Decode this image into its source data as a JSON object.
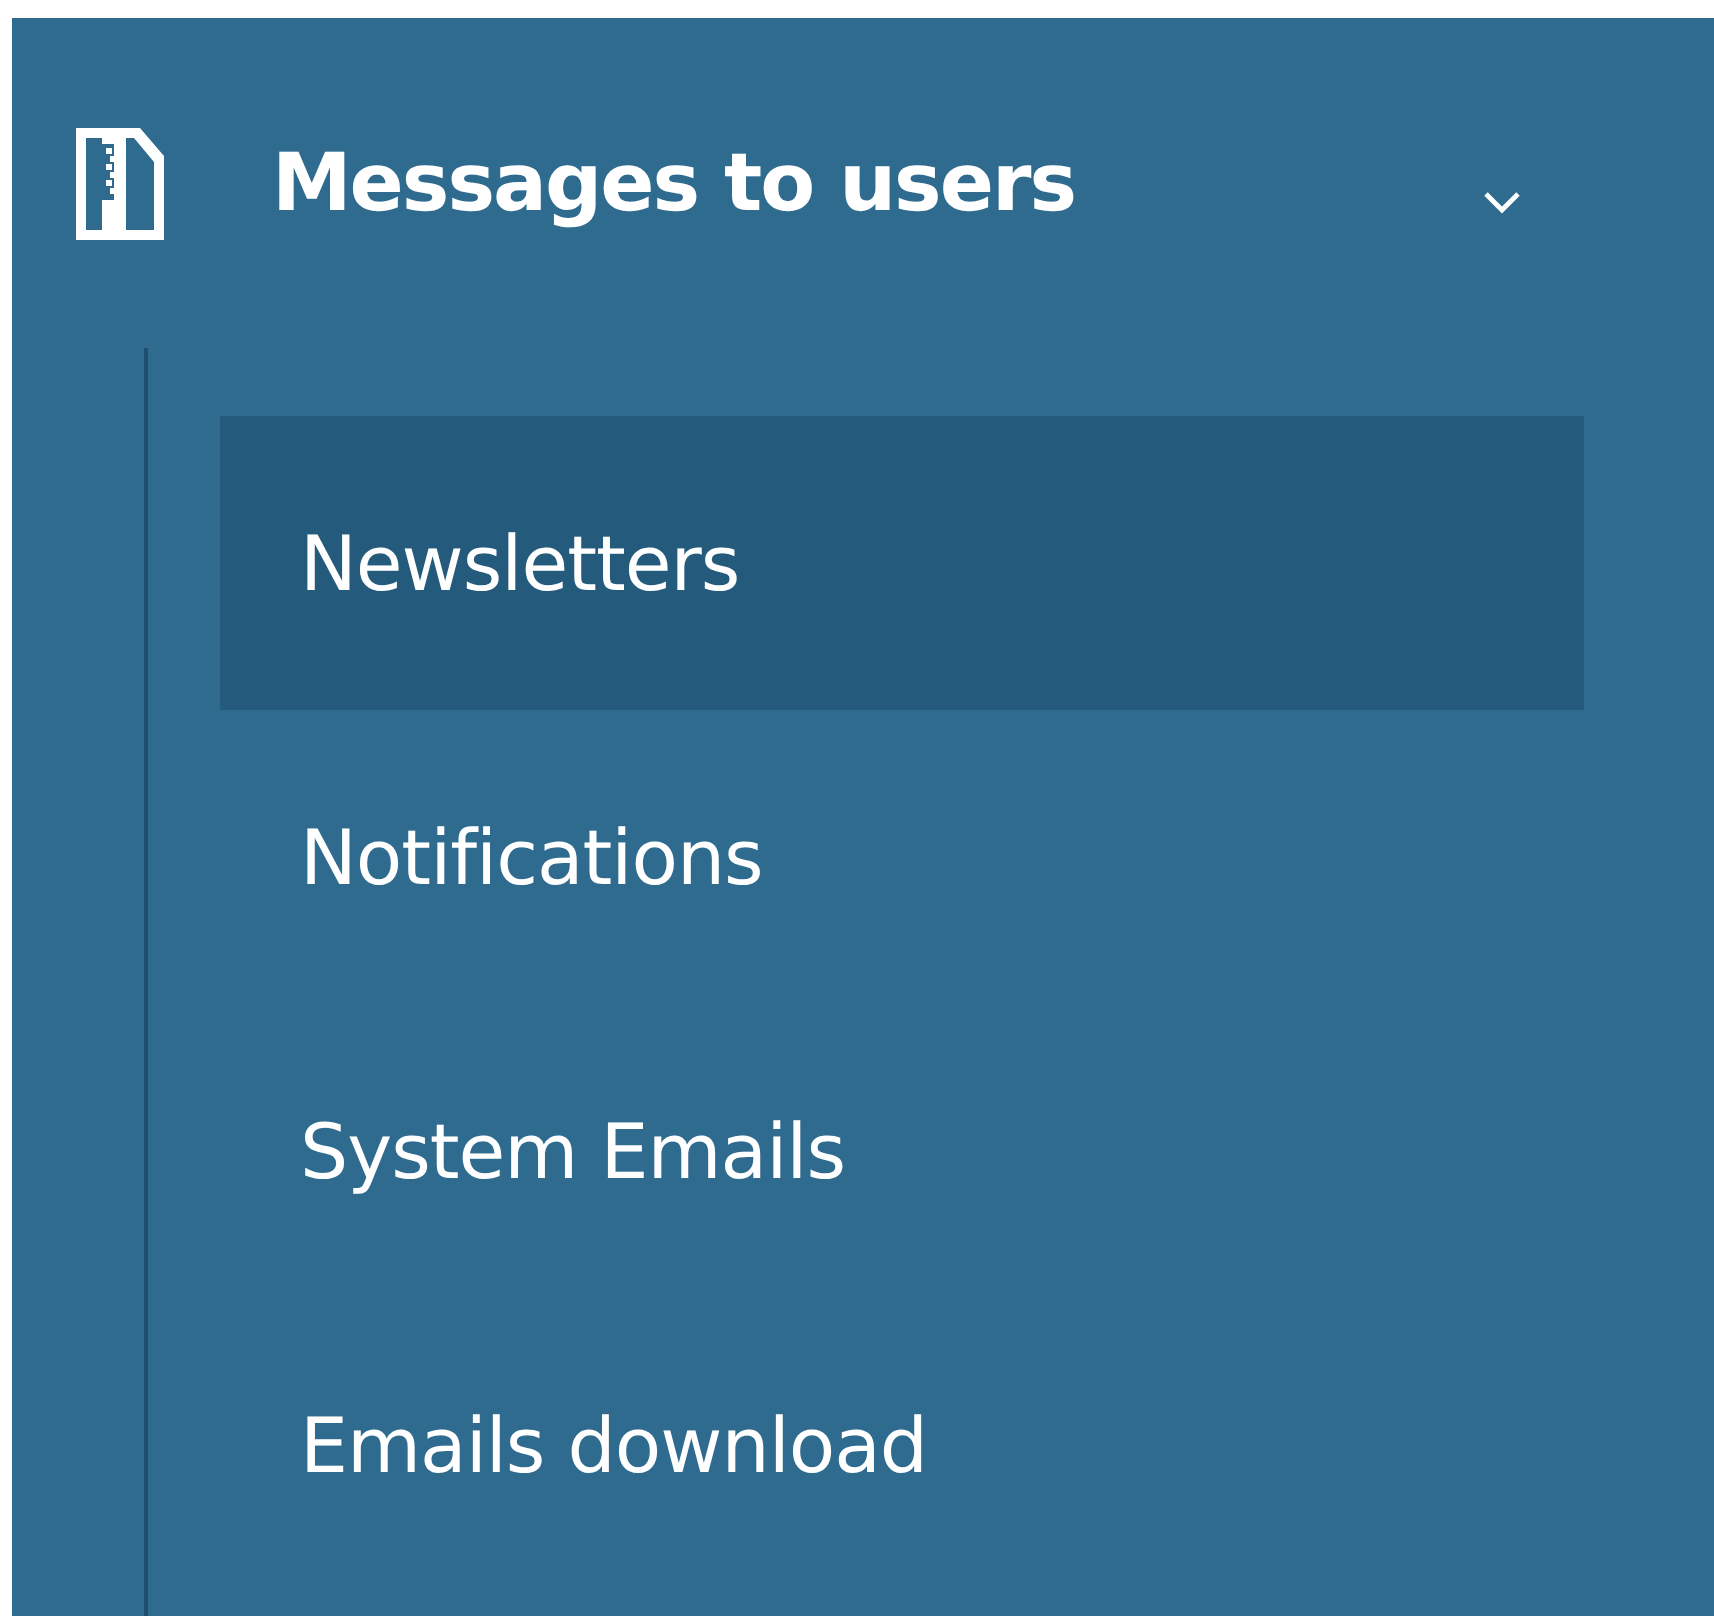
{
  "menu": {
    "title": "Messages to users",
    "expanded": true,
    "items": [
      {
        "label": "Newsletters",
        "selected": true
      },
      {
        "label": "Notifications",
        "selected": false
      },
      {
        "label": "System Emails",
        "selected": false
      },
      {
        "label": "Emails download",
        "selected": false
      }
    ]
  }
}
